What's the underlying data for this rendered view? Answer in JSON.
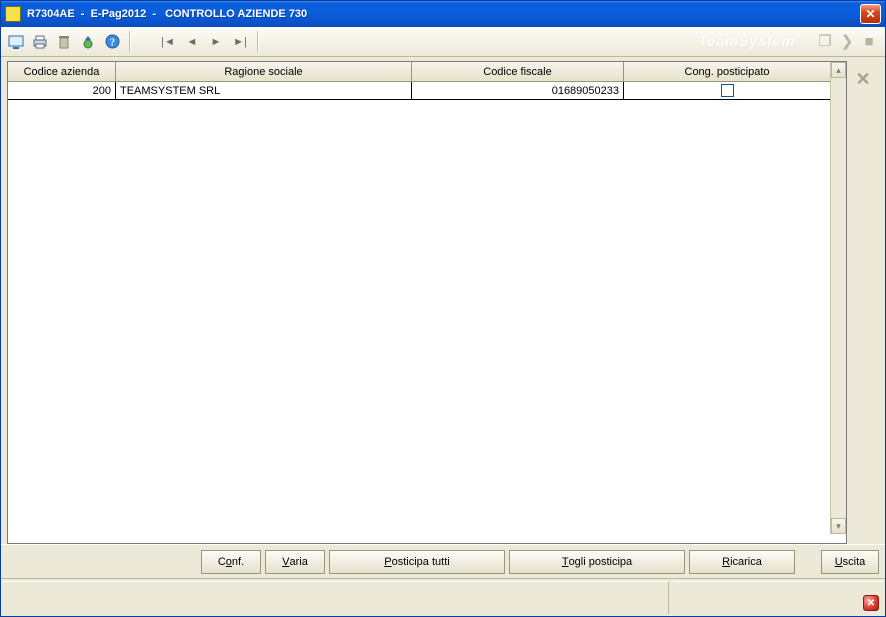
{
  "window": {
    "title": "R7304AE  -  E-Pag2012  -   CONTROLLO AZIENDE 730"
  },
  "toolbar": {
    "brand": "TeamSystem"
  },
  "grid": {
    "columns": {
      "codice_azienda": "Codice azienda",
      "ragione_sociale": "Ragione sociale",
      "codice_fiscale": "Codice fiscale",
      "cong_posticipato": "Cong. posticipato"
    },
    "rows": [
      {
        "codice_azienda": "200",
        "ragione_sociale": "TEAMSYSTEM SRL",
        "codice_fiscale": "01689050233",
        "cong_posticipato": false
      }
    ]
  },
  "buttons": {
    "conf_pre": "C",
    "conf_ul": "o",
    "conf_post": "nf.",
    "varia_pre": "",
    "varia_ul": "V",
    "varia_post": "aria",
    "posticipa_pre": "",
    "posticipa_ul": "P",
    "posticipa_post": "osticipa tutti",
    "togli_pre": "",
    "togli_ul": "T",
    "togli_post": "ogli posticipa",
    "ricarica_pre": "",
    "ricarica_ul": "R",
    "ricarica_post": "icarica",
    "uscita_pre": "",
    "uscita_ul": "U",
    "uscita_post": "scita"
  }
}
